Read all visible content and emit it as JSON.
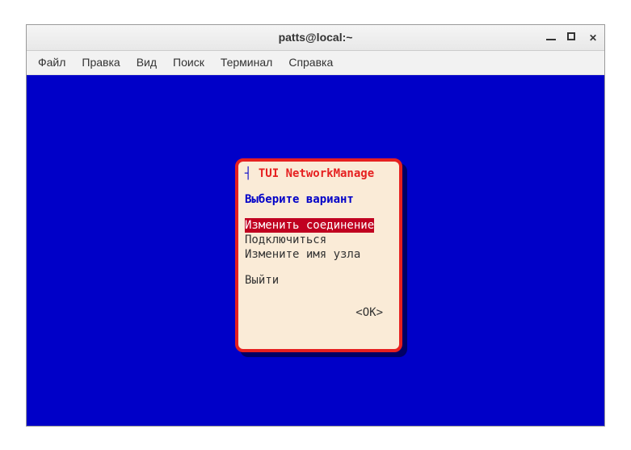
{
  "window": {
    "title": "patts@local:~"
  },
  "menubar": {
    "items": [
      "Файл",
      "Правка",
      "Вид",
      "Поиск",
      "Терминал",
      "Справка"
    ]
  },
  "dialog": {
    "title": "TUI NetworkManage",
    "subtitle": "Выберите вариант",
    "options": [
      {
        "label": "Изменить соединение",
        "selected": true
      },
      {
        "label": "Подключиться",
        "selected": false
      },
      {
        "label": "Измените имя узла",
        "selected": false
      }
    ],
    "quit": "Выйти",
    "ok": "<OK>"
  }
}
